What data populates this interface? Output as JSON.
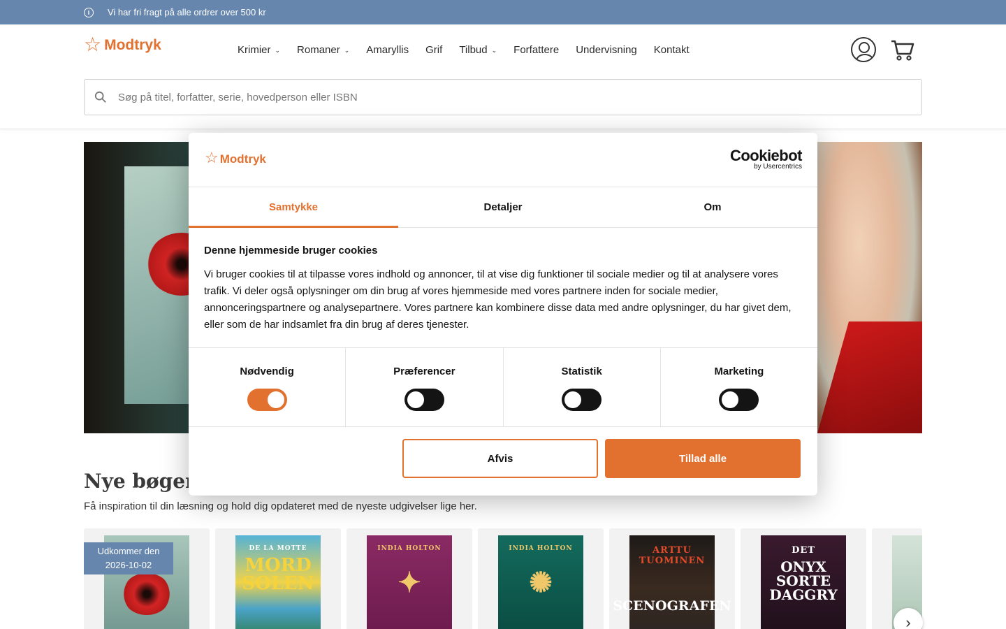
{
  "topbar": {
    "info_icon": "info-icon",
    "message": "Vi har fri fragt på alle ordrer over 500 kr"
  },
  "header": {
    "logo_text": "Modtryk",
    "nav": [
      {
        "label": "Krimier",
        "has_dropdown": true
      },
      {
        "label": "Romaner",
        "has_dropdown": true
      },
      {
        "label": "Amaryllis",
        "has_dropdown": false
      },
      {
        "label": "Grif",
        "has_dropdown": false
      },
      {
        "label": "Tilbud",
        "has_dropdown": true
      },
      {
        "label": "Forfattere",
        "has_dropdown": false
      },
      {
        "label": "Undervisning",
        "has_dropdown": false
      },
      {
        "label": "Kontakt",
        "has_dropdown": false
      }
    ],
    "search_placeholder": "Søg på titel, forfatter, serie, hovedperson eller ISBN"
  },
  "new_books": {
    "title": "Nye bøger",
    "subtitle": "Få inspiration til din læsning og hold dig opdateret med de nyeste udgivelser lige her.",
    "release_badge": {
      "line1": "Udkommer den",
      "line2": "2026-10-02"
    },
    "books": [
      {
        "cover_color": "#7fa89e",
        "line1": "",
        "line2": ""
      },
      {
        "cover_color": "#4aa3c8",
        "line1": "DE LA MOTTE",
        "line2": "MORD SOLEN"
      },
      {
        "cover_color": "#7a2158",
        "line1": "INDIA HOLTON",
        "line2": ""
      },
      {
        "cover_color": "#0f5a4f",
        "line1": "INDIA HOLTON",
        "line2": ""
      },
      {
        "cover_color": "#2a2522",
        "line1": "ARTTU TUOMINEN",
        "line2": "SCENOGRAFEN"
      },
      {
        "cover_color": "#3a1a2e",
        "line1": "DET",
        "line2": "ONYX SORTE DAGGRY"
      }
    ]
  },
  "cookie_dialog": {
    "logo_text": "Modtryk",
    "provider": "Cookiebot",
    "provider_sub": "by Usercentrics",
    "tabs": [
      {
        "label": "Samtykke",
        "active": true
      },
      {
        "label": "Detaljer",
        "active": false
      },
      {
        "label": "Om",
        "active": false
      }
    ],
    "heading": "Denne hjemmeside bruger cookies",
    "body": "Vi bruger cookies til at tilpasse vores indhold og annoncer, til at vise dig funktioner til sociale medier og til at analysere vores trafik. Vi deler også oplysninger om din brug af vores hjemmeside med vores partnere inden for sociale medier, annonceringspartnere og analysepartnere. Vores partnere kan kombinere disse data med andre oplysninger, du har givet dem, eller som de har indsamlet fra din brug af deres tjenester.",
    "categories": [
      {
        "label": "Nødvendig",
        "enabled": true
      },
      {
        "label": "Præferencer",
        "enabled": false
      },
      {
        "label": "Statistik",
        "enabled": false
      },
      {
        "label": "Marketing",
        "enabled": false
      }
    ],
    "decline_label": "Afvis",
    "accept_label": "Tillad alle"
  },
  "colors": {
    "accent": "#e2702f",
    "topbar": "#6686ae",
    "text": "#141414"
  }
}
